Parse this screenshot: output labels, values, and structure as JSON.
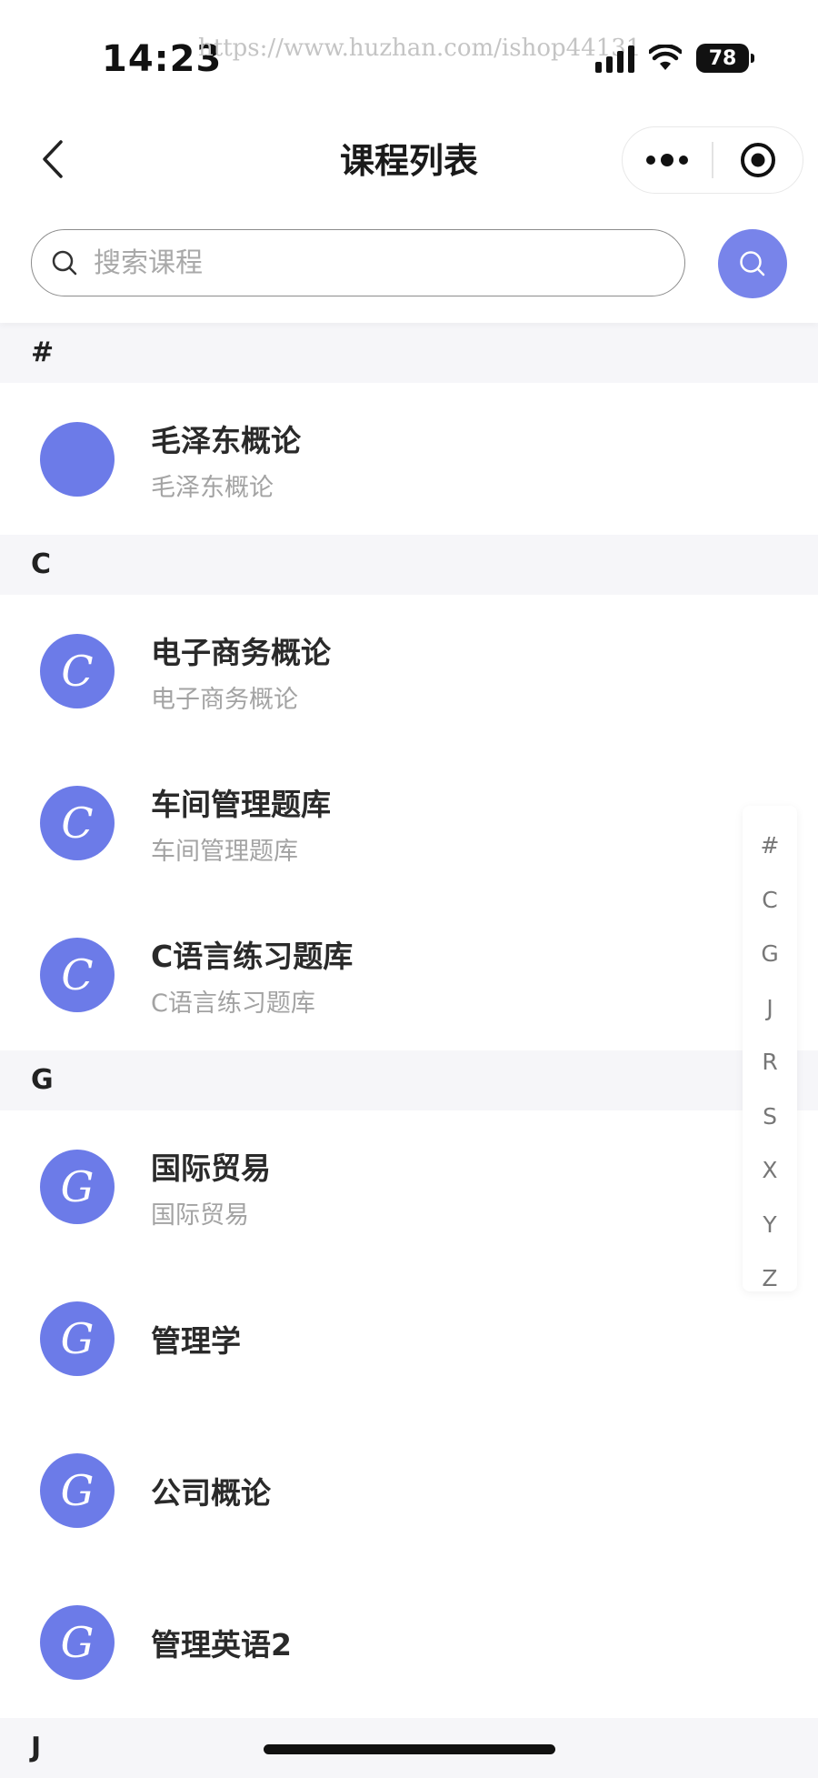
{
  "status_bar": {
    "time": "14:23",
    "watermark": "https://www.huzhan.com/ishop44131",
    "battery": "78",
    "icons": [
      "signal-icon",
      "wifi-icon",
      "battery-icon"
    ]
  },
  "nav": {
    "title": "课程列表",
    "back_icon": "chevron-left-icon",
    "more_icon": "more-dots-icon",
    "close_icon": "target-circle-icon"
  },
  "search": {
    "placeholder": "搜索课程",
    "value": "",
    "icon": "search-icon",
    "button_icon": "search-icon"
  },
  "colors": {
    "accent": "#6c7be8",
    "section_bg": "#f6f6f9"
  },
  "sections": [
    {
      "letter": "#",
      "items": [
        {
          "avatar": "",
          "name": "毛泽东概论",
          "sub": "毛泽东概论"
        }
      ]
    },
    {
      "letter": "C",
      "items": [
        {
          "avatar": "C",
          "name": "电子商务概论",
          "sub": "电子商务概论"
        },
        {
          "avatar": "C",
          "name": "车间管理题库",
          "sub": "车间管理题库"
        },
        {
          "avatar": "C",
          "name": "C语言练习题库",
          "sub": "C语言练习题库"
        }
      ]
    },
    {
      "letter": "G",
      "items": [
        {
          "avatar": "G",
          "name": "国际贸易",
          "sub": "国际贸易"
        },
        {
          "avatar": "G",
          "name": "管理学",
          "sub": ""
        },
        {
          "avatar": "G",
          "name": "公司概论",
          "sub": ""
        },
        {
          "avatar": "G",
          "name": "管理英语2",
          "sub": ""
        }
      ]
    },
    {
      "letter": "J",
      "items": []
    }
  ],
  "index_bar": [
    "#",
    "C",
    "G",
    "J",
    "R",
    "S",
    "X",
    "Y",
    "Z"
  ]
}
